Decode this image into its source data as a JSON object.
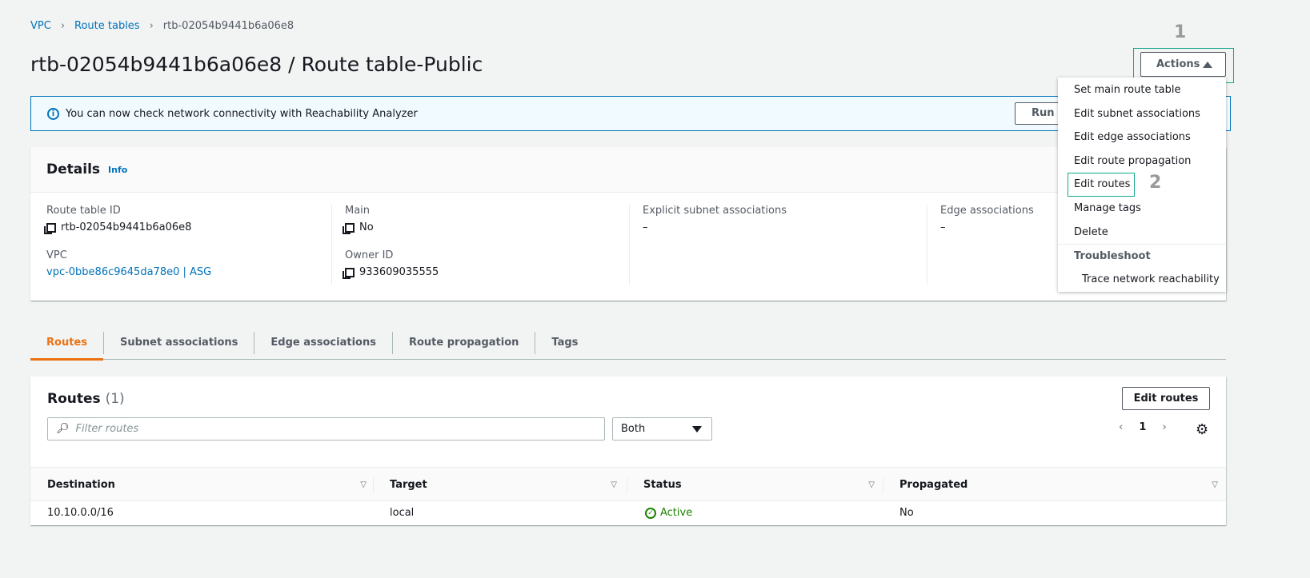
{
  "breadcrumb": {
    "items": [
      "VPC",
      "Route tables"
    ],
    "current": "rtb-02054b9441b6a06e8"
  },
  "title": "rtb-02054b9441b6a06e8 / Route table-Public",
  "banner": {
    "text": "You can now check network connectivity with Reachability Analyzer",
    "button": "Run Reachability Analyzer",
    "button_visible": "Run R"
  },
  "actions": {
    "label": "Actions",
    "menu": [
      "Set main route table",
      "Edit subnet associations",
      "Edit edge associations",
      "Edit route propagation",
      "Edit routes",
      "Manage tags",
      "Delete"
    ],
    "section": "Troubleshoot",
    "section_items": [
      "Trace network reachability"
    ]
  },
  "annotations": {
    "step1": "1",
    "step2": "2",
    "highlight_color": "#15a88a"
  },
  "details": {
    "title": "Details",
    "info": "Info",
    "fields": {
      "route_table_id_label": "Route table ID",
      "route_table_id": "rtb-02054b9441b6a06e8",
      "main_label": "Main",
      "main": "No",
      "explicit_label": "Explicit subnet associations",
      "explicit": "–",
      "edge_label": "Edge associations",
      "edge": "–",
      "vpc_label": "VPC",
      "vpc": "vpc-0bbe86c9645da78e0 | ASG",
      "owner_label": "Owner ID",
      "owner": "933609035555"
    }
  },
  "tabs": [
    "Routes",
    "Subnet associations",
    "Edge associations",
    "Route propagation",
    "Tags"
  ],
  "routes": {
    "title": "Routes",
    "count": "(1)",
    "edit": "Edit routes",
    "filter_placeholder": "Filter routes",
    "select": "Both",
    "page": "1",
    "columns": [
      "Destination",
      "Target",
      "Status",
      "Propagated"
    ],
    "rows": [
      {
        "destination": "10.10.0.0/16",
        "target": "local",
        "status": "Active",
        "propagated": "No"
      }
    ]
  },
  "colors": {
    "accent": "#ec7211",
    "link": "#0073bb",
    "success": "#1d8102"
  }
}
